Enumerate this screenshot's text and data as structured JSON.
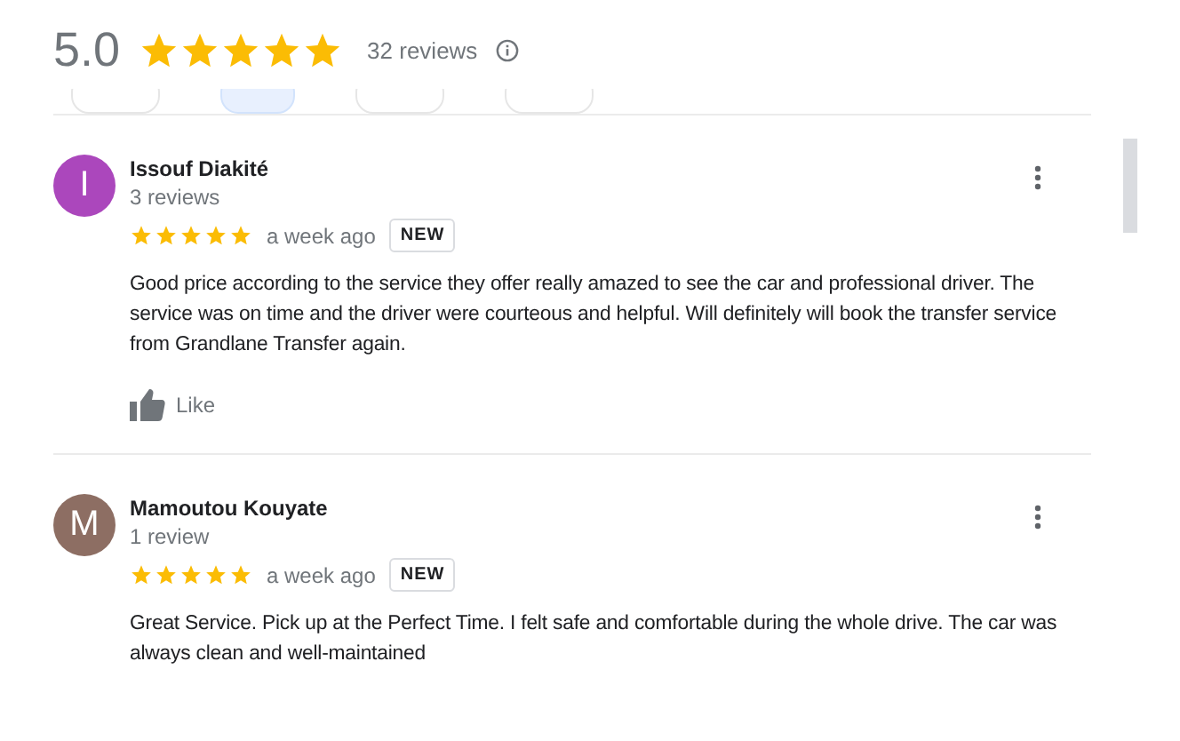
{
  "summary": {
    "score": "5.0",
    "stars": 5,
    "count": "32 reviews"
  },
  "filter_chips": [
    {
      "selected": false
    },
    {
      "selected": true
    },
    {
      "selected": false
    },
    {
      "selected": false
    }
  ],
  "reviews": [
    {
      "initial": "I",
      "color": "#ab47bc",
      "name": "Issouf Diakité",
      "reviewer_count": "3 reviews",
      "stars": 5,
      "time": "a week ago",
      "badge": "NEW",
      "text": "Good price according to the service they offer really amazed to see the car and professional driver. The service was on time and the driver were courteous and helpful. Will definitely will book the transfer service from Grandlane Transfer again.",
      "like": "Like"
    },
    {
      "initial": "M",
      "color": "#8d6e63",
      "name": "Mamoutou Kouyate",
      "reviewer_count": "1 review",
      "stars": 5,
      "time": "a week ago",
      "badge": "NEW",
      "text": "Great Service. Pick up at the Perfect Time. I felt safe and comfortable during the whole drive. The car was always clean and well-maintained"
    }
  ]
}
